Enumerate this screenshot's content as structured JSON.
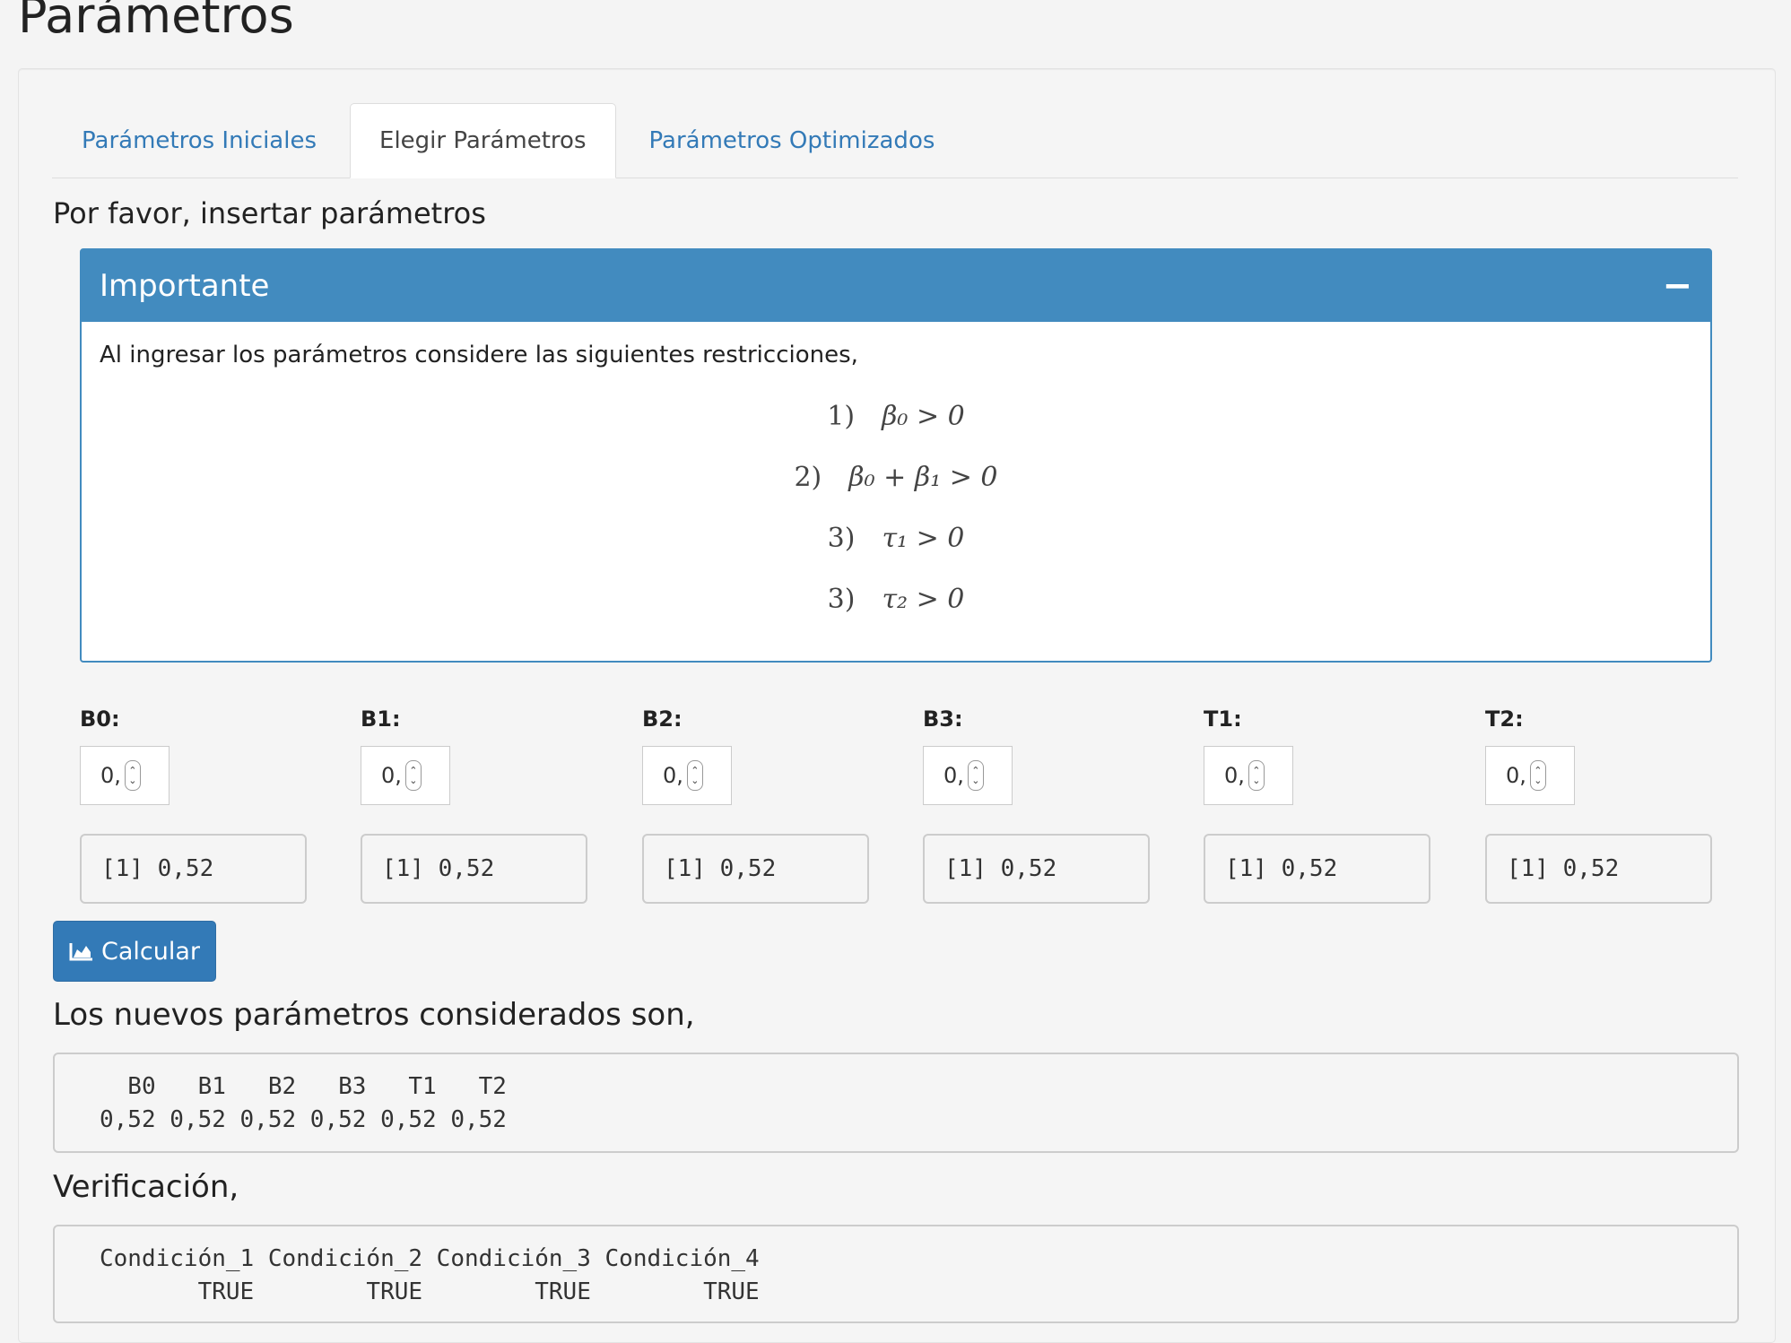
{
  "page": {
    "title": "Parámetros"
  },
  "tabs": [
    {
      "label": "Parámetros Iniciales"
    },
    {
      "label": "Elegir Parámetros"
    },
    {
      "label": "Parámetros Optimizados"
    }
  ],
  "lead": "Por favor, insertar parámetros",
  "box": {
    "title": "Importante",
    "collapse_symbol": "−",
    "text": "Al ingresar los parámetros considere las siguientes restricciones,",
    "equations": [
      {
        "num": "1)",
        "expr": "β₀ > 0"
      },
      {
        "num": "2)",
        "expr": "β₀ + β₁ > 0"
      },
      {
        "num": "3)",
        "expr": "τ₁ > 0"
      },
      {
        "num": "3)",
        "expr": "τ₂ > 0"
      }
    ]
  },
  "params": [
    {
      "label": "B0:",
      "value": "0,",
      "output": "[1] 0,52"
    },
    {
      "label": "B1:",
      "value": "0,",
      "output": "[1] 0,52"
    },
    {
      "label": "B2:",
      "value": "0,",
      "output": "[1] 0,52"
    },
    {
      "label": "B3:",
      "value": "0,",
      "output": "[1] 0,52"
    },
    {
      "label": "T1:",
      "value": "0,",
      "output": "[1] 0,52"
    },
    {
      "label": "T2:",
      "value": "0,",
      "output": "[1] 0,52"
    }
  ],
  "button": {
    "label": "Calcular",
    "icon": "area-chart-icon"
  },
  "results": {
    "title": "Los nuevos parámetros considerados son,",
    "table": "  B0   B1   B2   B3   T1   T2\n0,52 0,52 0,52 0,52 0,52 0,52"
  },
  "verification": {
    "title": "Verificación,",
    "table": "Condición_1 Condición_2 Condición_3 Condición_4\n       TRUE        TRUE        TRUE        TRUE"
  },
  "colors": {
    "primary": "#337ab7",
    "box_header": "#428bbf",
    "background": "#f4f4f4"
  }
}
